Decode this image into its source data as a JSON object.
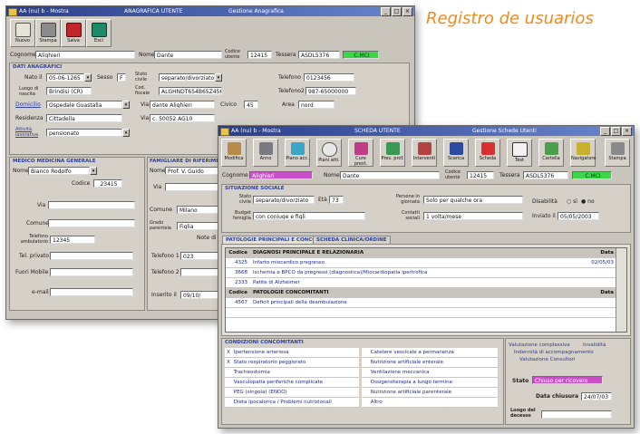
{
  "page_title": "Registro de usuarios",
  "colors": {
    "accent_orange": "#f08a1c",
    "title_blue": "#2a3d8a",
    "green_status": "#3bd64a",
    "magenta_field": "#c84fc7"
  },
  "window_back": {
    "title": "AA (nu) b - Mostra",
    "title_mid": "ANAGRAFICA UTENTE",
    "title_right": "Gestione Anagrafica",
    "toolbar": [
      {
        "label": "Nuovo",
        "icon": "new-icon"
      },
      {
        "label": "Stampa",
        "icon": "print-icon"
      },
      {
        "label": "Salva",
        "icon": "save-icon"
      },
      {
        "label": "Esci",
        "icon": "exit-icon"
      }
    ],
    "top": {
      "cognome_label": "Cognome",
      "cognome": "Alighieri",
      "nome_label": "Nome",
      "nome": "Dante",
      "codice_label": "Codice utente",
      "codice": "12415",
      "tessera_label": "Tessera",
      "tessera": "ASDL5376",
      "status": "C.MCI"
    },
    "dati": {
      "title": "DATI ANAGRAFICI",
      "nato_label": "Nato il",
      "nato": "05-06-1265",
      "sesso_label": "Sesso",
      "sesso": "F",
      "stato_label": "Stato civile",
      "stato": "separato/divorziato",
      "telefono_label": "Telefono",
      "telefono": "0123456",
      "luogo_label": "Luogo di nascita",
      "luogo": "Brindisi (CR)",
      "codfisc_label": "Cod. fiscale",
      "codfisc": "ALGHNDT654B65Z456",
      "telefono2_label": "Telefono2",
      "telefono2": "987-65000000",
      "domicilio_label": "Domicilio",
      "domicilio": "Ospedale Guastalla",
      "via_label": "Via",
      "via": "dante Alighieri",
      "civico_label": "Civico",
      "civico": "45",
      "area_label": "Area",
      "area": "nord",
      "residenza_label": "Residenza",
      "residenza": "Cittadella",
      "via2_label": "Via",
      "via2": "c. 50052 AG10",
      "attivita_label": "Attività lavorativa",
      "attivita": "pensionato"
    },
    "medico": {
      "title": "MEDICO MEDICINA GENERALE",
      "nome_label": "Nome",
      "nome": "Bianco Rodolfo",
      "codice_label": "Codice",
      "codice": "23415",
      "via_label": "Via",
      "comune_label": "Comune",
      "telefono_label": "Telefono ambulatorio",
      "telefono": "12345",
      "telprivato_label": "Tel. privato",
      "fuori_label": "Fuori Mobile",
      "email_label": "e-mail"
    },
    "famigliare": {
      "title": "FAMIGLIARE DI RIFERIMENTO",
      "nome_label": "Nome",
      "nome": "Prof. V. Guido",
      "via_label": "Via",
      "comune_label": "Comune",
      "comune": "Milano",
      "grado_label": "Grado parentela",
      "grado": "Figlia",
      "telefono1_label": "Telefono 1",
      "telefono1": "023",
      "telefono2_label": "Telefono 2",
      "note_label": "Note di si",
      "inserito_label": "Inserito il",
      "inserito": "09/10/"
    }
  },
  "window_front": {
    "title": "AA (nu) b - Mostra",
    "title_mid": "SCHEDA UTENTE",
    "title_right": "Gestione Schede Utenti",
    "toolbar": [
      {
        "label": "Modifica",
        "icon": "edit-icon"
      },
      {
        "label": "Anno",
        "icon": "calendar-icon"
      },
      {
        "label": "Piano acc.",
        "icon": "gem-icon"
      },
      {
        "label": "Piani atti.",
        "icon": "clock-icon"
      },
      {
        "label": "Cure prest.",
        "icon": "palette-icon"
      },
      {
        "label": "Pres. prof.",
        "icon": "folder-icon"
      },
      {
        "label": "Interventi",
        "icon": "calendar-grid-icon"
      },
      {
        "label": "Scarica",
        "icon": "disk-icon"
      },
      {
        "label": "Scheda",
        "icon": "trophy-icon"
      },
      {
        "label": "Test",
        "icon": "book-icon"
      },
      {
        "label": "Cartella",
        "icon": "folder-open-icon"
      },
      {
        "label": "Navigatore",
        "icon": "bus-icon"
      },
      {
        "label": "Stampa",
        "icon": "printer-icon"
      }
    ],
    "top": {
      "cognome_label": "Cognome",
      "cognome": "Alighieri",
      "nome_label": "Nome",
      "nome": "Dante",
      "codice_label": "Codice utente",
      "codice": "12415",
      "tessera_label": "Tessera",
      "tessera": "ASDL5376",
      "status": "C.MCI"
    },
    "situazione": {
      "title": "SITUAZIONE SOCIALE",
      "stato_label": "Stato civile",
      "stato": "separato/divorziato",
      "eta_label": "Età",
      "eta": "73",
      "persone_label": "Persone in giornata",
      "persone": "Solo per qualche ora",
      "disabilita_label": "Disabilità",
      "disabilita_opts": [
        "sì",
        "no"
      ],
      "budget_label": "Budget famiglia",
      "budget": "con coniuge e figli",
      "contatti_label": "Contatti sociali",
      "contatti": "1 volta/mese",
      "inviato_label": "Inviato il",
      "inviato": "05/05/2003"
    },
    "tabs": [
      "PATOLOGIE PRINCIPALI E CONCOMITANTI",
      "SCHEDA CLINICA/ORDINE"
    ],
    "table1": {
      "headers": [
        "Codice",
        "DIAGNOSI PRINCIPALE E RELAZIONARIA",
        "Data"
      ],
      "rows": [
        {
          "code": "4325",
          "desc": "Infarto miocardico pregresso",
          "date": "02/05/03"
        },
        {
          "code": "3668",
          "desc": "Ischemia e BPCO da pregressi (diagnostica)/Miocardiopatia ipertrofica",
          "date": ""
        },
        {
          "code": "2333",
          "desc": "Patite di Alzheimer",
          "date": ""
        }
      ]
    },
    "table2": {
      "headers": [
        "Codice",
        "PATOLOGIE CONCOMITANTI",
        "Data"
      ],
      "rows": [
        {
          "code": "4567",
          "desc": "Deficit principali della deambulazione",
          "date": ""
        }
      ]
    },
    "condizioni": {
      "title": "CONDIZIONI CONCOMITANTI",
      "left": [
        {
          "mark": "X",
          "label": "Ipertensione arteriosa"
        },
        {
          "mark": "X",
          "label": "Stato respiratorio peggiorato"
        },
        {
          "mark": "",
          "label": "Tracheostomia"
        },
        {
          "mark": "",
          "label": "Vasculopatia periferiche complicate"
        },
        {
          "mark": "",
          "label": "PEG (singola) (ENDO)"
        },
        {
          "mark": "",
          "label": "Dieta ipocalorica / Problemi nutrizionali"
        }
      ],
      "right": [
        "Catetere vescicale a permanenza",
        "Nutrizione artificiale enterale",
        "Ventilazione meccanica",
        "Ossigenoterapia a lungo termine",
        "Nutrizione artificiale parenterale",
        "Altro"
      ]
    },
    "valutazione": {
      "line1": "Valutazione complessiva",
      "line1b": "Invalidità",
      "line2": "Indennità di accompagnamento",
      "line3": "Valutazione Consultori",
      "stato_label": "Stato",
      "stato": "Chiuso per ricovero",
      "data_label": "Data chiusura",
      "data": "24/07/03",
      "luogo_label": "Luogo del decesso"
    }
  }
}
